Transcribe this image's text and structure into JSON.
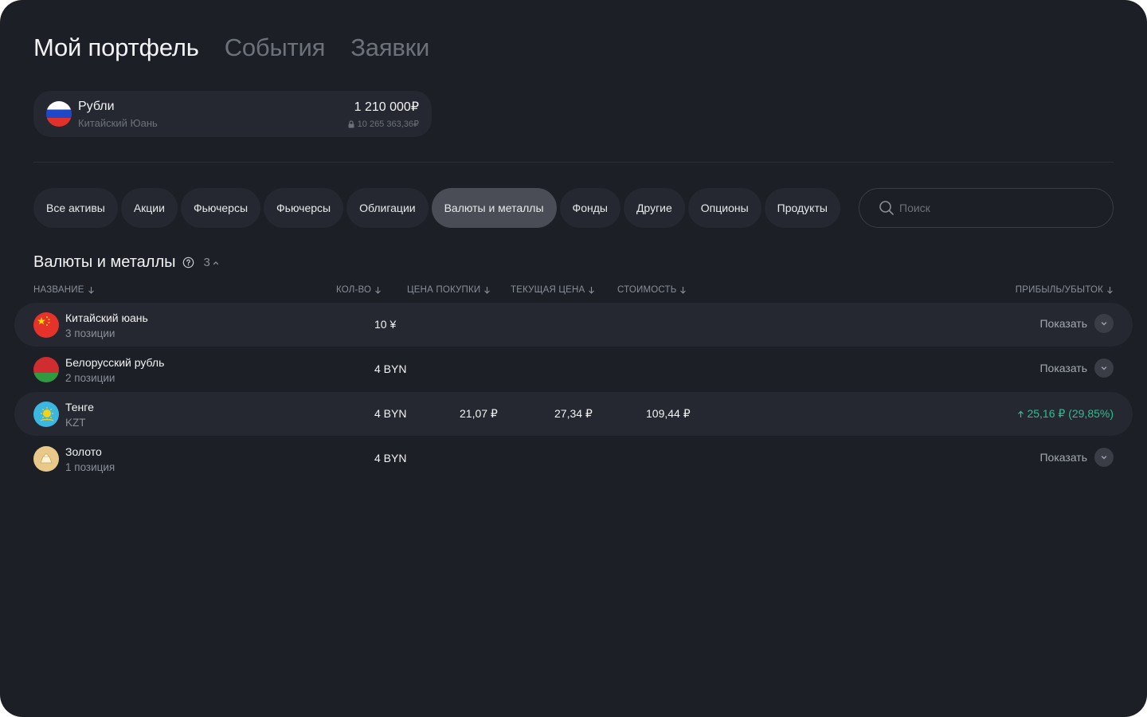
{
  "header": {
    "tabs": [
      {
        "label": "Мой портфель",
        "active": true
      },
      {
        "label": "События",
        "active": false
      },
      {
        "label": "Заявки",
        "active": false
      }
    ]
  },
  "account": {
    "title": "Рубли",
    "subtitle": "Китайский Юань",
    "amount": "1 210 000₽",
    "blocked": "10 265 363,36₽",
    "flag": "russia-flag-icon"
  },
  "filters": {
    "chips": [
      "Все активы",
      "Акции",
      "Фьючерсы",
      "Фьючерсы",
      "Облигации",
      "Валюты и металлы",
      "Фонды",
      "Другие",
      "Опционы",
      "Продукты"
    ],
    "active": "Валюты и металлы"
  },
  "search": {
    "placeholder": "Поиск",
    "value": ""
  },
  "section": {
    "title": "Валюты и металлы",
    "count": "3"
  },
  "table": {
    "columns": {
      "name": "НАЗВАНИЕ",
      "qty": "КОЛ-ВО",
      "buy_price": "ЦЕНА ПОКУПКИ",
      "current_price": "ТЕКУЩАЯ ЦЕНА",
      "value": "СТОИМОСТЬ",
      "pnl": "ПРИБЫЛЬ/УБЫТОК"
    },
    "show_label": "Показать",
    "rows": [
      {
        "name": "Китайский юань",
        "sub": "3 позиции",
        "qty": "10 ¥",
        "buy_price": "",
        "current_price": "",
        "value": "",
        "pnl": "",
        "icon": "china-flag-icon"
      },
      {
        "name": "Белорусский рубль",
        "sub": "2 позиции",
        "qty": "4 BYN",
        "buy_price": "",
        "current_price": "",
        "value": "",
        "pnl": "",
        "icon": "belarus-flag-icon"
      },
      {
        "name": "Тенге",
        "sub": "KZT",
        "qty": "4 BYN",
        "buy_price": "21,07 ₽",
        "current_price": "27,34 ₽",
        "value": "109,44 ₽",
        "pnl": "25,16 ₽ (29,85%)",
        "icon": "kazakhstan-flag-icon"
      },
      {
        "name": "Золото",
        "sub": "1 позиция",
        "qty": "4 BYN",
        "buy_price": "",
        "current_price": "",
        "value": "",
        "pnl": "",
        "icon": "gold-icon"
      }
    ]
  },
  "colors": {
    "background": "#1c1f26",
    "card": "#252830",
    "chip_active": "#4a4d55",
    "profit": "#2bbf91",
    "muted": "#6d717a"
  }
}
